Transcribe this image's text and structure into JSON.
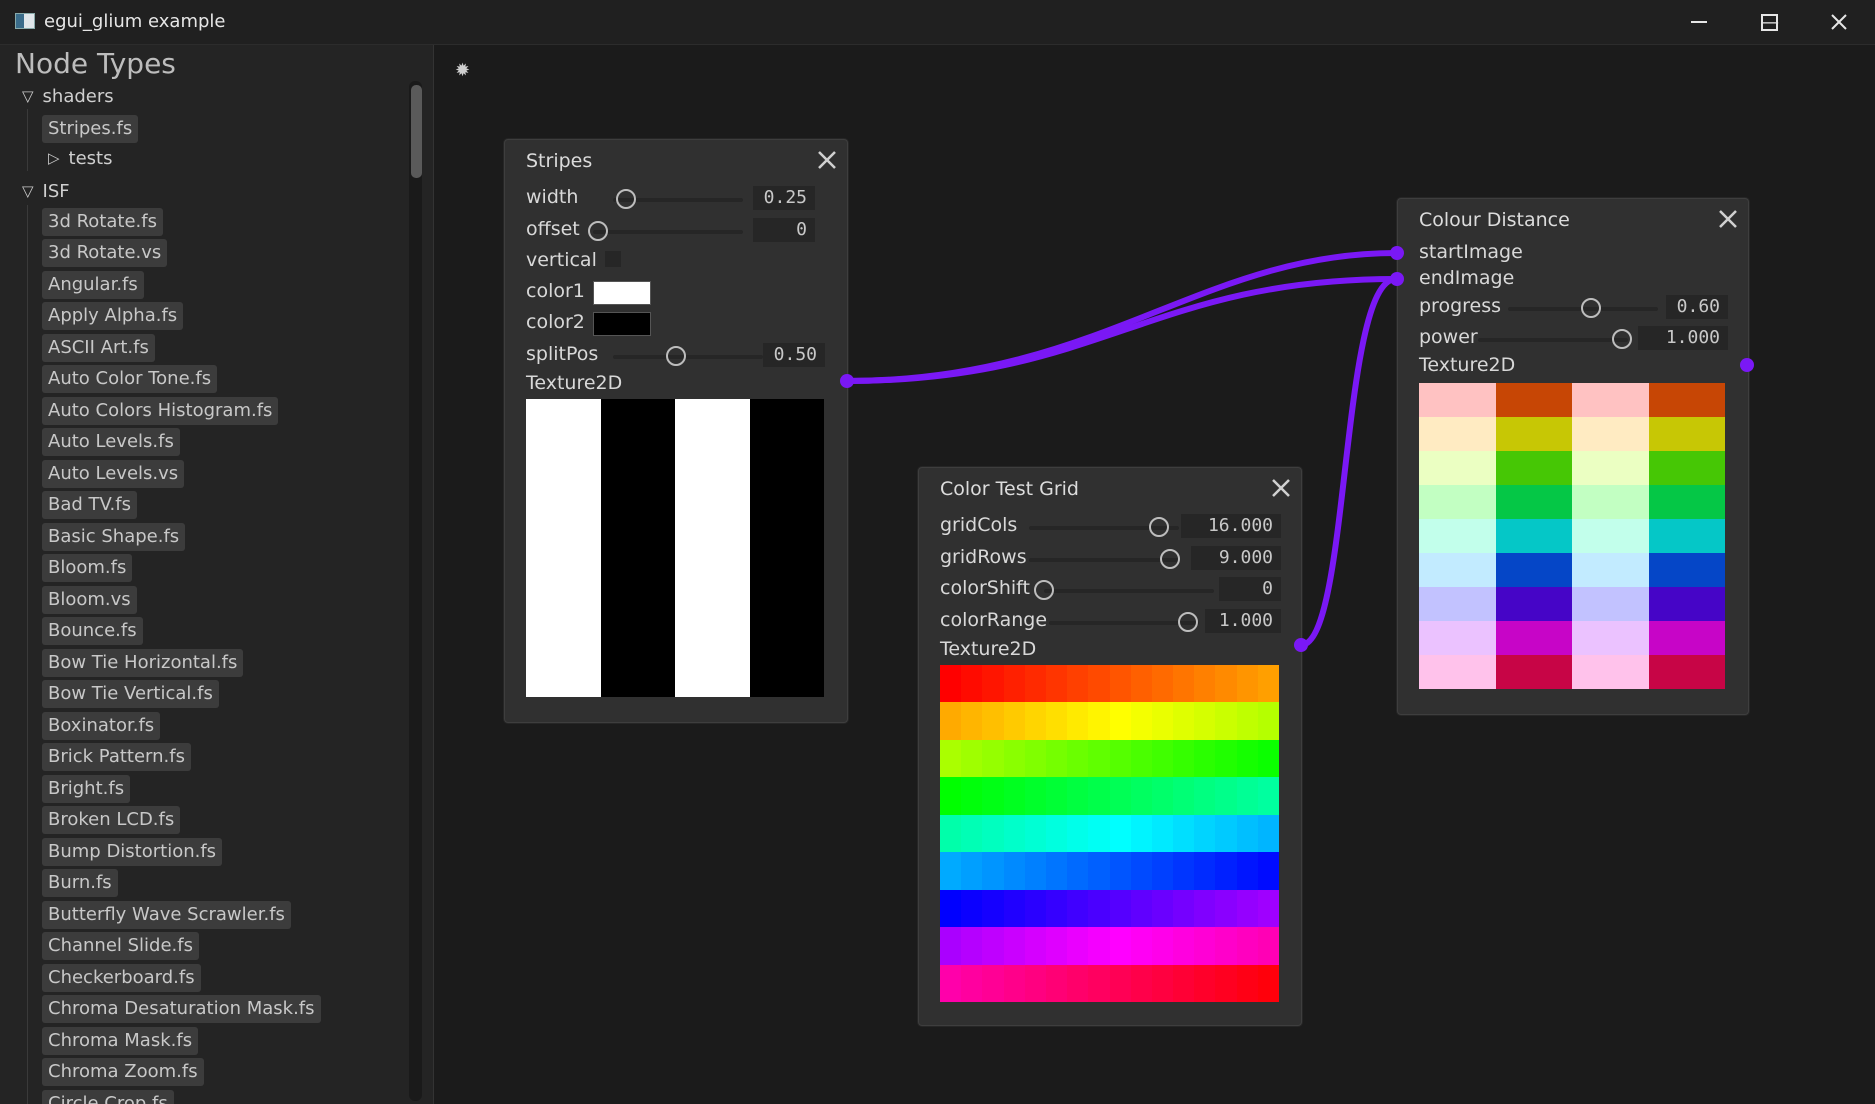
{
  "window": {
    "title": "egui_glium example",
    "minimize_icon": "minimize-icon",
    "maximize_icon": "maximize-icon",
    "close_icon": "close-icon"
  },
  "sidebar": {
    "heading": "Node Types",
    "groups": [
      {
        "label": "shaders",
        "expanded": true
      },
      {
        "label": "tests",
        "expanded": false
      },
      {
        "label": "ISF",
        "expanded": true
      }
    ],
    "shader_items": [
      "Stripes.fs"
    ],
    "isf_items": [
      "3d Rotate.fs",
      "3d Rotate.vs",
      "Angular.fs",
      "Apply Alpha.fs",
      "ASCII Art.fs",
      "Auto Color Tone.fs",
      "Auto Colors Histogram.fs",
      "Auto Levels.fs",
      "Auto Levels.vs",
      "Bad TV.fs",
      "Basic Shape.fs",
      "Bloom.fs",
      "Bloom.vs",
      "Bounce.fs",
      "Bow Tie Horizontal.fs",
      "Bow Tie Vertical.fs",
      "Boxinator.fs",
      "Brick Pattern.fs",
      "Bright.fs",
      "Broken LCD.fs",
      "Bump Distortion.fs",
      "Burn.fs",
      "Butterfly Wave Scrawler.fs",
      "Channel Slide.fs",
      "Checkerboard.fs",
      "Chroma Desaturation Mask.fs",
      "Chroma Mask.fs",
      "Chroma Zoom.fs",
      "Circle Crop.fs"
    ]
  },
  "canvas": {
    "sparkle_icon": "sparkle-icon",
    "link_color": "#7a18f5"
  },
  "nodes": {
    "stripes": {
      "title": "Stripes",
      "params": [
        {
          "label": "width",
          "value": "0.25",
          "level": 0.25
        },
        {
          "label": "offset",
          "value": "0",
          "level": 0.0
        },
        {
          "label": "vertical"
        },
        {
          "label": "color1",
          "color": "#ffffff"
        },
        {
          "label": "color2",
          "color": "#000000"
        },
        {
          "label": "splitPos",
          "value": "0.50",
          "level": 0.5
        }
      ],
      "output_label": "Texture2D"
    },
    "color_test_grid": {
      "title": "Color Test Grid",
      "params": [
        {
          "label": "gridCols",
          "value": "16.000"
        },
        {
          "label": "gridRows",
          "value": "9.000"
        },
        {
          "label": "colorShift",
          "value": "0"
        },
        {
          "label": "colorRange",
          "value": "1.000"
        }
      ],
      "output_label": "Texture2D"
    },
    "colour_distance": {
      "title": "Colour Distance",
      "inputs": [
        "startImage",
        "endImage"
      ],
      "params": [
        {
          "label": "progress",
          "value": "0.60",
          "level": 0.6
        },
        {
          "label": "power",
          "value": "1.000"
        }
      ],
      "output_label": "Texture2D"
    }
  }
}
